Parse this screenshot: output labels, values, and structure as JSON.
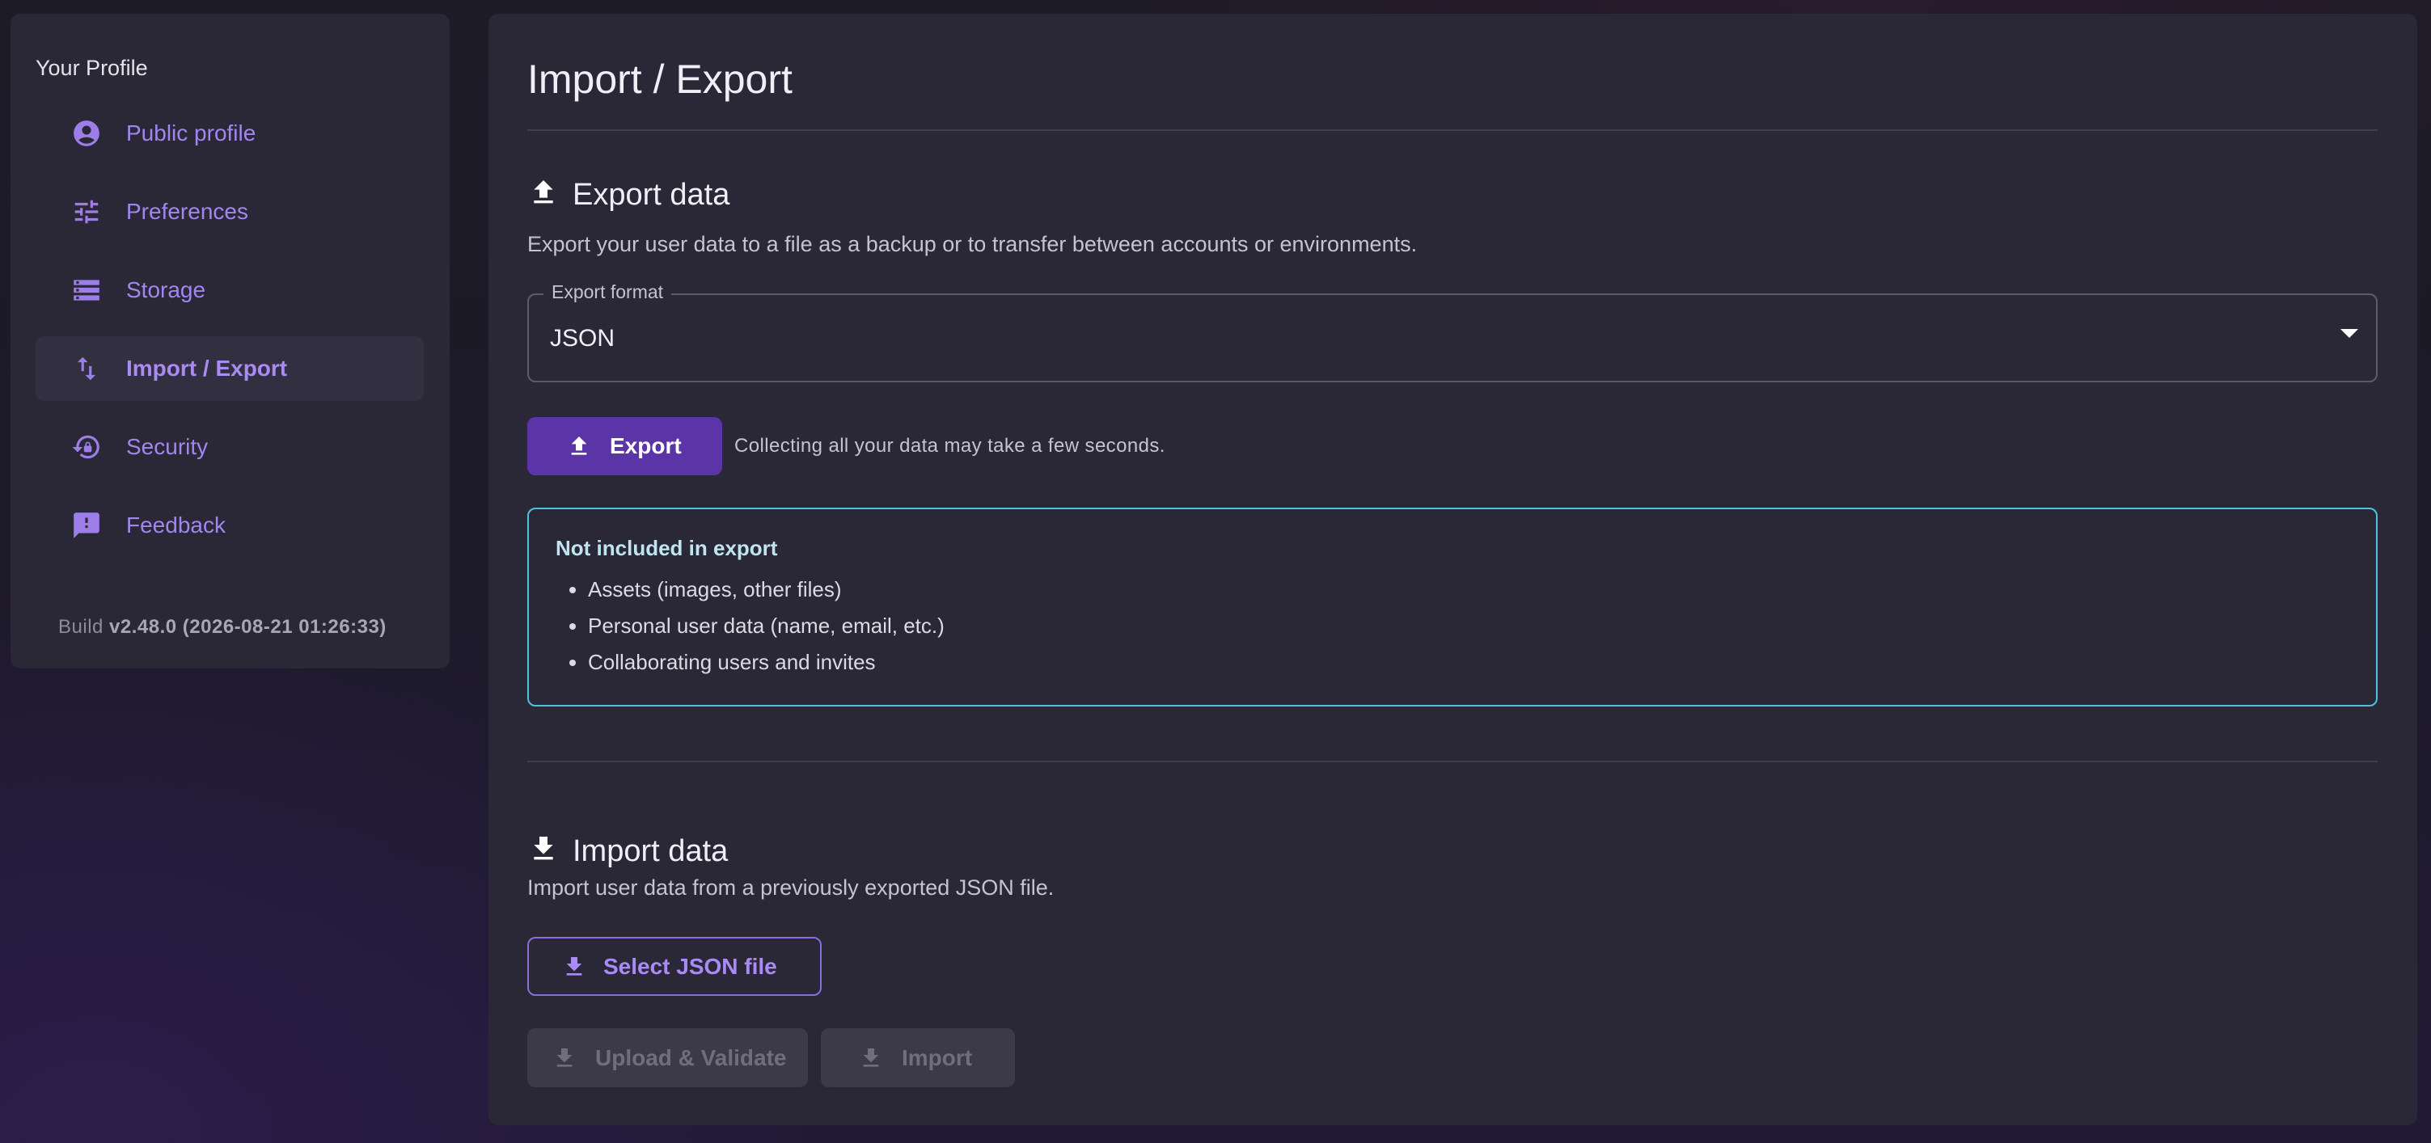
{
  "sidebar": {
    "title": "Your Profile",
    "items": [
      {
        "label": "Public profile",
        "icon": "account-circle-icon",
        "active": false
      },
      {
        "label": "Preferences",
        "icon": "tune-sliders-icon",
        "active": false
      },
      {
        "label": "Storage",
        "icon": "storage-list-icon",
        "active": false
      },
      {
        "label": "Import / Export",
        "icon": "import-export-arrows-icon",
        "active": true
      },
      {
        "label": "Security",
        "icon": "lock-reset-icon",
        "active": false
      },
      {
        "label": "Feedback",
        "icon": "feedback-icon",
        "active": false
      }
    ],
    "build_prefix": "Build",
    "build_version": "v2.48.0 (2026-08-21 01:26:33)"
  },
  "main": {
    "title": "Import / Export",
    "export": {
      "heading": "Export data",
      "description": "Export your user data to a file as a backup or to transfer between accounts or environments.",
      "format_label": "Export format",
      "format_value": "JSON",
      "button_label": "Export",
      "hint": "Collecting all your data may take a few seconds.",
      "notice": {
        "title": "Not included in export",
        "items": [
          "Assets (images, other files)",
          "Personal user data (name, email, etc.)",
          "Collaborating users and invites"
        ]
      }
    },
    "import": {
      "heading": "Import data",
      "description": "Import user data from a previously exported JSON file.",
      "select_button": "Select JSON file",
      "upload_button": "Upload & Validate",
      "import_button": "Import"
    }
  },
  "colors": {
    "accent": "#5b34a8",
    "accent_text": "#a98bf5",
    "info_border": "#4fc1dd",
    "panel": "#2a2836"
  }
}
